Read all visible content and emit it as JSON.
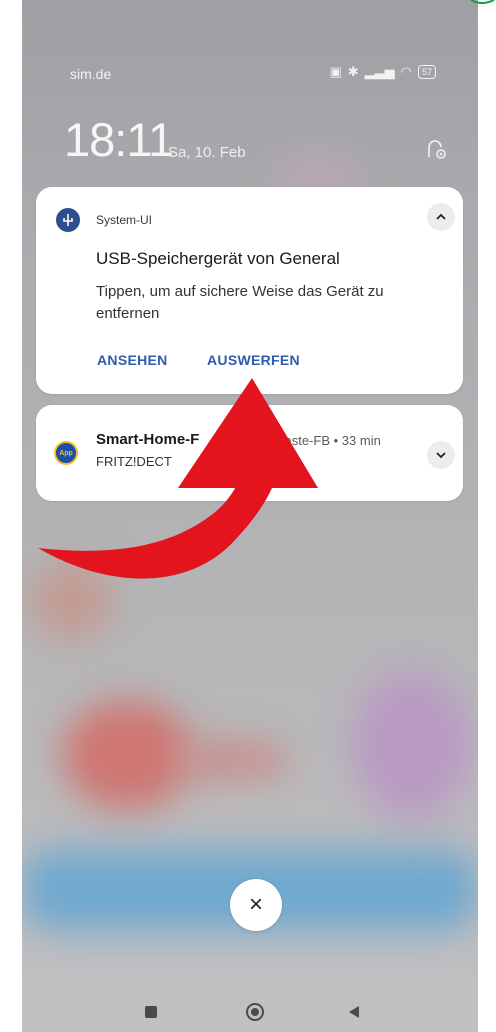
{
  "status_bar": {
    "carrier": "sim.de",
    "battery": "57"
  },
  "lockscreen": {
    "time": "18:11",
    "date": "Sa, 10. Feb"
  },
  "notifications": [
    {
      "app": "System-UI",
      "title": "USB-Speichergerät von General",
      "text": "Tippen, um auf sichere Weise das Gerät zu entfernen",
      "actions": [
        "ANSEHEN",
        "AUSWERFEN"
      ]
    },
    {
      "title": "Smart-Home-F",
      "source": "caste-FB • 33 min",
      "text": "FRITZ!DECT"
    }
  ],
  "dismiss_label": "×",
  "colors": {
    "accent": "#2f5bb0",
    "arrow": "#e3141d",
    "card": "#ffffff"
  },
  "icons": [
    "usb-icon",
    "fritz-app-icon",
    "chevron-up-icon",
    "chevron-down-icon",
    "settings-icon",
    "close-icon",
    "recents-icon",
    "home-icon",
    "back-icon"
  ]
}
